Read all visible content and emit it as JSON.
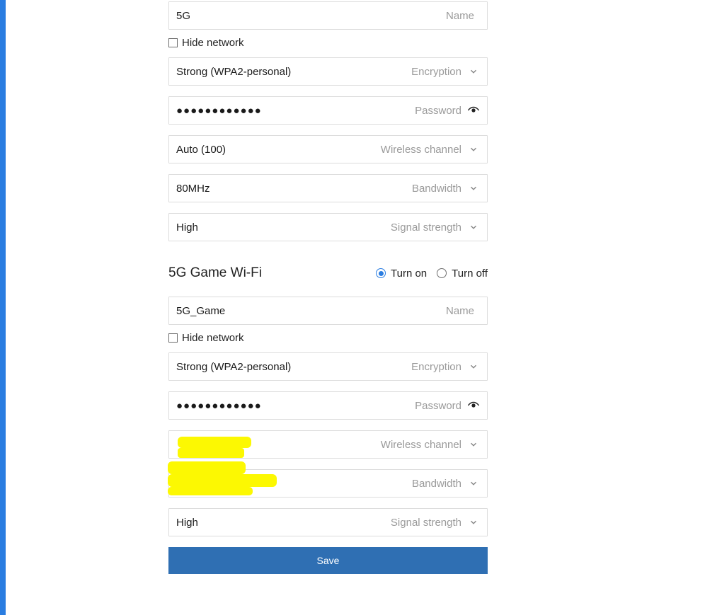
{
  "section1": {
    "name_value": "5G",
    "name_label": "Name",
    "hide_label": "Hide network",
    "encryption_value": "Strong (WPA2-personal)",
    "encryption_label": "Encryption",
    "password_value": "●●●●●●●●●●●●",
    "password_label": "Password",
    "channel_value": "Auto (100)",
    "channel_label": "Wireless channel",
    "bandwidth_value": "80MHz",
    "bandwidth_label": "Bandwidth",
    "signal_value": "High",
    "signal_label": "Signal strength"
  },
  "section2": {
    "title": "5G Game Wi-Fi",
    "turn_on": "Turn on",
    "turn_off": "Turn off",
    "name_value": "5G_Game",
    "name_label": "Name",
    "hide_label": "Hide network",
    "encryption_value": "Strong (WPA2-personal)",
    "encryption_label": "Encryption",
    "password_value": "●●●●●●●●●●●●",
    "password_label": "Password",
    "channel_value": "",
    "channel_label": "Wireless channel",
    "bandwidth_value": "",
    "bandwidth_label": "Bandwidth",
    "signal_value": "High",
    "signal_label": "Signal strength"
  },
  "buttons": {
    "save": "Save"
  }
}
